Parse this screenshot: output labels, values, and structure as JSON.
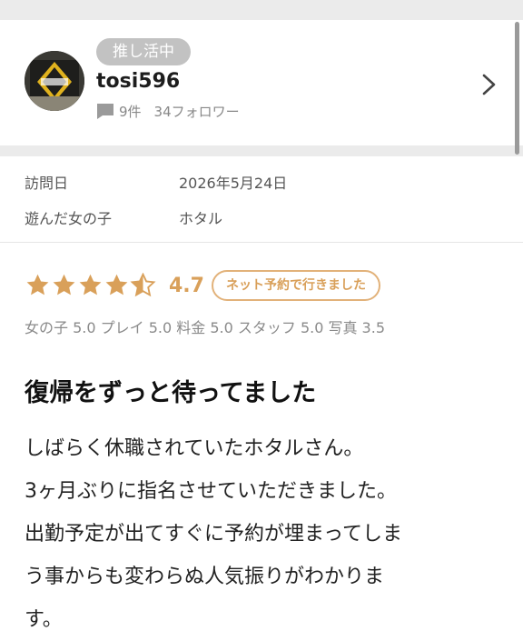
{
  "profile": {
    "badge": "推し活中",
    "username": "tosi596",
    "review_count": "9件",
    "followers": "34フォロワー"
  },
  "visit": {
    "date_label": "訪問日",
    "date_value": "2026年5月24日",
    "girl_label": "遊んだ女の子",
    "girl_value": "ホタル"
  },
  "rating": {
    "stars": 4.5,
    "score": "4.7",
    "booking_badge": "ネット予約で行きました",
    "star_color": "#d9a05a",
    "subratings": "女の子 5.0 プレイ 5.0 料金 5.0 スタッフ 5.0 写真 3.5"
  },
  "review": {
    "title": "復帰をずっと待ってました",
    "lines": [
      "しばらく休職されていたホタルさん。",
      "3ヶ月ぶりに指名させていただきました。",
      "出勤予定が出てすぐに予約が埋まってしま",
      "う事からも変わらぬ人気振りがわかりま",
      "す。"
    ]
  }
}
